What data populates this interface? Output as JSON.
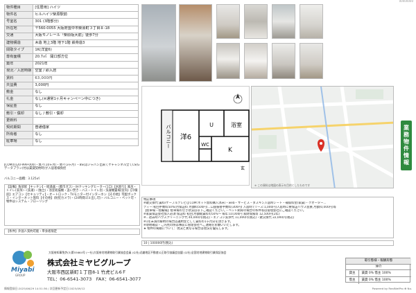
{
  "top_id": "00000000",
  "spec": {
    "rows": [
      {
        "k": "物件種目",
        "v": "[住居用] ハイツ"
      },
      {
        "k": "物件名",
        "v": "ヒルハイツ柴原駅前"
      },
      {
        "k": "号室名",
        "v": "301 (3階部分)"
      },
      {
        "k": "所在地",
        "v": "〒560-0055 大阪府豊中市柴原町３丁目８-18"
      },
      {
        "k": "交通",
        "v": "大阪モノレール「柴原阪大前」徒歩7分"
      },
      {
        "k": "建物構造",
        "v": "木造 地上3階 地下1階 鉄骨造3"
      },
      {
        "k": "間取タイプ",
        "v": "1K(洋室6)"
      },
      {
        "k": "専有面積",
        "v": "20.7㎡　開口部方位"
      },
      {
        "k": "築年",
        "v": "2021年"
      },
      {
        "k": "現況／入居時期",
        "v": "空室 / 即入居"
      },
      {
        "k": "賃料",
        "v": "63,000円"
      },
      {
        "k": "共益費",
        "v": "3,000円"
      },
      {
        "k": "敷金",
        "v": "なし"
      },
      {
        "k": "礼金",
        "v": "なし(※通常1ヶ月キャンペーン中につき)"
      },
      {
        "k": "保証金",
        "v": "なし"
      },
      {
        "k": "敷引・償却",
        "v": "なし / 敷引・償却"
      },
      {
        "k": "更新料",
        "v": ""
      },
      {
        "k": "契約期間",
        "v": "普通借家"
      },
      {
        "k": "所有者",
        "v": "なし"
      },
      {
        "k": "駐車場",
        "v": "なし"
      }
    ]
  },
  "left_notes": "JCOM(0120-999-000)・無イ(10ヶ月)・地イ(3ヶ月) ・BS(はジャパン出来てケチャンネル全てCS(Gデータプラン)付は賃貸契約時)が入居者様負担",
  "balcony": "バルコニー面積：3.125㎡",
  "facilities": "【設備】角部屋【キッチン】・給湯器・(都市ガス)・IHクッキングヒーター(1口)【水廻り】風呂・トイレ(洗浄)・(洗濯)・(独立)・浴室乾燥機・追い焚き・バス・トイレ別・洗濯機置場(室内)【冷暖房】エアコン【セキュリティ】・オートロック・TVモニター付インターホン【その他】宅配ボックス・インターネット無料【その他】(防犯カメラ)・(24時間ゴミ出し可)・バルコニー・ペット可・物件はシステム・フローリング",
  "conditions": "【条件】外国人契約可能・単身者限定",
  "floorplan": {
    "main": "洋6",
    "bath": "浴室",
    "wc": "WC",
    "k": "K",
    "balcony": "バルコニー",
    "entrance": "玄",
    "u": "U"
  },
  "map": {
    "note": "※ この資料は地図の表示を目的としたものです"
  },
  "notes_block": "特記事項\n家賃保証会社(株)...マンション建物保険・ケーブルテレビ利用料は無料...取扱い",
  "notes_lines": [
    "特記事項",
    "※鍵交換代:賃料/ケーブルテレビ(J:COM:ネット無料購入済み)・web・サービス・ダスキン入居時シート・補償料金(家賃)・クオーター...",
    "ティー:初回手数料50%(月保証料 月額料500円)...口座振替手数料(300円) 入居時:(リース:1,000円)入居時に要保証ハウス会員 月額(0,000円)等",
    "【駐車場・駐輪場】駐車場の空き状況は以下ご確認ください。・ペット飼育の場合の条件等は管理会社にご確認ください。",
    "※家賃保証会社加入必須 保証料 初回:月額総賃料の50%〜 毎年:10,000円 家財保険等 12,500円(2年)",
    "※...退去時ハウスクリーニング代 40,000円(税込)・エアコン洗浄代 11,000円(税込)・鍵交換代 22,000円(税込)",
    "※1年未満の解約の場合は違約金として賃料の1ヶ月分を頂きます。",
    "※現地確認・ご内見の際は事前に管理会社へご連絡をお願いいたします。",
    "★ 物件の掲載について：現況と異なる場合は現況を優先します。"
  ],
  "ad_note": "10 | 100000円(税込)",
  "footer": {
    "license": "大阪府知事免許(3)第55664号 (一社)大阪府宅地建物取引業協会会員 (公社)近畿地区不動産公正取引協議会加盟 (公社)全国宅地建物取引業保証協会",
    "company": "株式会社ミヤビグループ",
    "address": "大阪市西区新町１丁目8-1 竹虎ビル6Ｆ",
    "tel": "TEL：06-6541-3073　FAX：06-6541-3077",
    "logo_text": "Miyabi",
    "logo_sub": "GROUP",
    "transaction_title": "取引態様・報酬形態",
    "transaction_type": "仲介",
    "fee_rows": [
      {
        "k": "貸主",
        "v": "賃貸 0% 借主 100%"
      },
      {
        "k": "借主",
        "v": "賃貸 0% 借主 100%"
      }
    ],
    "dates": "情報登録日:2025/06/29 14:51:36 / 次回更新予定日:2025/09/12",
    "powered": "Powered by RealNetPro ⊕ No."
  },
  "side_label": [
    "業",
    "務",
    "物",
    "件",
    "情",
    "報"
  ]
}
